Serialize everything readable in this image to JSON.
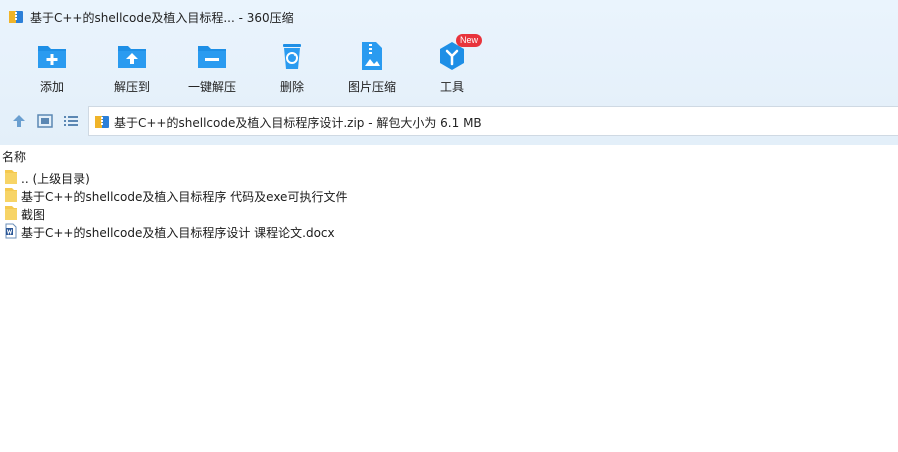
{
  "window": {
    "title": "基于C++的shellcode及植入目标程... - 360压缩"
  },
  "toolbar": {
    "items": [
      {
        "label": "添加",
        "icon": "folder-add-icon"
      },
      {
        "label": "解压到",
        "icon": "folder-extract-icon"
      },
      {
        "label": "一键解压",
        "icon": "folder-one-click-extract-icon"
      },
      {
        "label": "删除",
        "icon": "recycle-bin-icon"
      },
      {
        "label": "图片压缩",
        "icon": "image-compress-icon"
      },
      {
        "label": "工具",
        "icon": "tools-icon",
        "badge": "New"
      }
    ]
  },
  "navbar": {
    "path": "基于C++的shellcode及植入目标程序设计.zip - 解包大小为 6.1 MB"
  },
  "list": {
    "column_name": "名称",
    "rows": [
      {
        "name": ".. (上级目录)",
        "type": "folder"
      },
      {
        "name": "基于C++的shellcode及植入目标程序 代码及exe可执行文件",
        "type": "folder"
      },
      {
        "name": "截图",
        "type": "folder"
      },
      {
        "name": "基于C++的shellcode及植入目标程序设计 课程论文.docx",
        "type": "docx"
      }
    ]
  },
  "colors": {
    "accent": "#1e8fe6",
    "toolbar_bg": "#e6f1fb",
    "badge": "#e8343c",
    "folder": "#f5c94f"
  }
}
